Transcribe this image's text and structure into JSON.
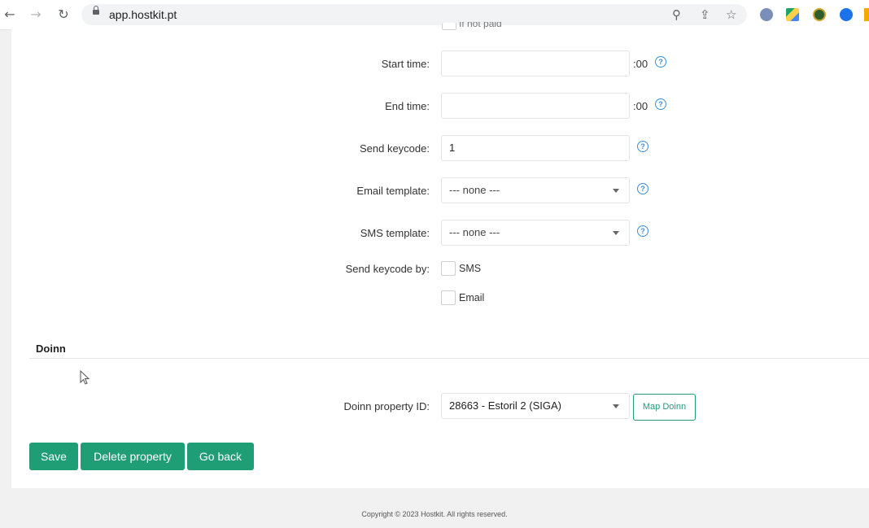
{
  "browser": {
    "url": "app.hostkit.pt"
  },
  "form": {
    "partial_top_label": "If not paid",
    "start_time": {
      "label": "Start time:",
      "value": "",
      "suffix": ":00"
    },
    "end_time": {
      "label": "End time:",
      "value": "",
      "suffix": ":00"
    },
    "send_keycode": {
      "label": "Send keycode:",
      "value": "1"
    },
    "email_template": {
      "label": "Email template:",
      "value": "--- none ---"
    },
    "sms_template": {
      "label": "SMS template:",
      "value": "--- none ---"
    },
    "send_keycode_by": {
      "label": "Send keycode by:",
      "options": [
        "SMS",
        "Email"
      ]
    }
  },
  "doinn": {
    "section_title": "Doinn",
    "property_id_label": "Doinn property ID:",
    "property_id_value": "28663 - Estoril 2 (SIGA)",
    "map_button": "Map Doinn"
  },
  "actions": {
    "save": "Save",
    "delete": "Delete property",
    "back": "Go back"
  },
  "footer": {
    "copyright": "Copyright © 2023 Hostkit. All rights reserved."
  },
  "colors": {
    "primary": "#1f9d74",
    "help": "#3a8fd8"
  }
}
